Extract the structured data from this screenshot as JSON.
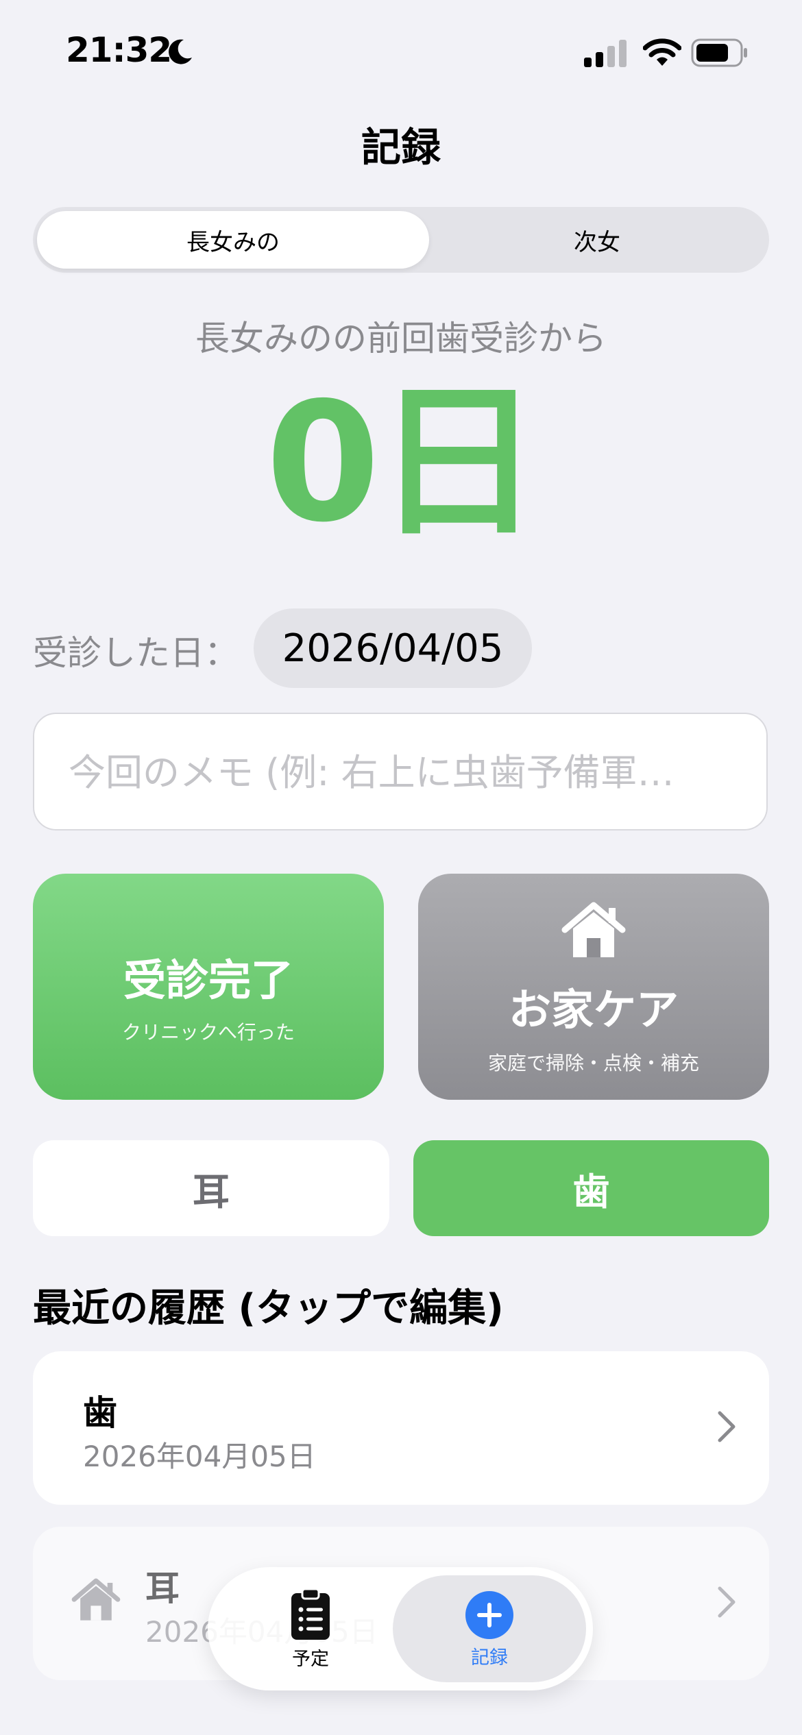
{
  "status_bar": {
    "time": "21:32",
    "icons": [
      "moon-icon",
      "cellular-signal-icon",
      "wifi-icon",
      "battery-icon"
    ]
  },
  "header": {
    "title": "記録"
  },
  "segmented": {
    "options": [
      "長女みの",
      "次女"
    ],
    "selected_index": 0
  },
  "counter": {
    "label": "長女みのの前回歯受診から",
    "value": "0日"
  },
  "visit": {
    "label": "受診した日：",
    "date": "2026/04/05"
  },
  "memo": {
    "placeholder": "今回のメモ (例: 右上に虫歯予備軍…",
    "value": ""
  },
  "actions": {
    "clinic": {
      "title": "受診完了",
      "subtitle": "クリニックへ行った"
    },
    "home": {
      "title": "お家ケア",
      "subtitle": "家庭で掃除・点検・補充",
      "icon": "house-icon"
    }
  },
  "types": {
    "options": [
      "耳",
      "歯"
    ],
    "selected": "歯"
  },
  "history": {
    "heading": "最近の履歴 (タップで編集)",
    "items": [
      {
        "type": "歯",
        "date": "2026年04月05日"
      },
      {
        "type": "耳",
        "date": "2026年04月05日",
        "icon": "house-icon"
      }
    ]
  },
  "tabbar": {
    "tabs": [
      {
        "label": "予定",
        "icon": "clipboard-list-icon"
      },
      {
        "label": "記録",
        "icon": "plus-circle-icon"
      }
    ],
    "selected_index": 1
  },
  "colors": {
    "accent_green": "#62c266",
    "accent_blue": "#2f7cf6",
    "gray_card": "#8d8d92",
    "background": "#f2f2f7"
  }
}
